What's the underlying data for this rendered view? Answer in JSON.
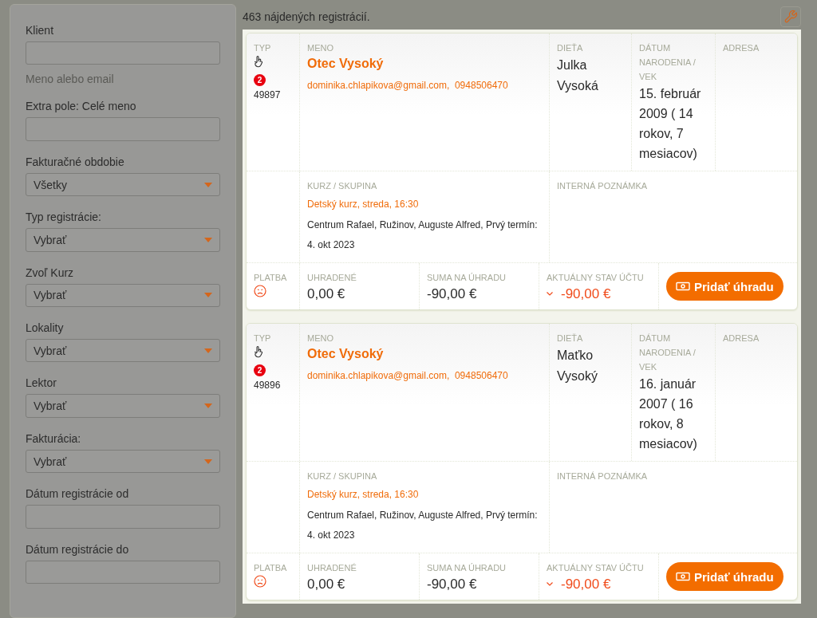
{
  "filters": [
    {
      "kind": "text",
      "label": "Klient",
      "hint": "Meno alebo email"
    },
    {
      "kind": "text",
      "label": "Extra pole: Celé meno"
    },
    {
      "kind": "select",
      "label": "Fakturačné obdobie",
      "value": "Všetky"
    },
    {
      "kind": "select",
      "label": "Typ registrácie:",
      "value": "Vybrať"
    },
    {
      "kind": "select",
      "label": "Zvoľ Kurz",
      "value": "Vybrať"
    },
    {
      "kind": "select",
      "label": "Lokality",
      "value": "Vybrať"
    },
    {
      "kind": "select",
      "label": "Lektor",
      "value": "Vybrať"
    },
    {
      "kind": "select",
      "label": "Fakturácia:",
      "value": "Vybrať"
    },
    {
      "kind": "text",
      "label": "Dátum registrácie od"
    },
    {
      "kind": "text",
      "label": "Dátum registrácie do"
    }
  ],
  "result_count": "463 nájdených registrácií.",
  "registrations": [
    {
      "headers": {
        "type": "TYP",
        "name": "MENO",
        "child": "DIEŤA",
        "birth": "DÁTUM NARODENIA / VEK",
        "address": "ADRESA",
        "course": "KURZ / SKUPINA",
        "note": "INTERNÁ POZNÁMKA",
        "payment": "PLATBA",
        "paid": "UHRADENÉ",
        "due": "SUMA NA ÚHRADU",
        "balance": "AKTUÁLNY STAV ÚČTU"
      },
      "badge": "2",
      "id": "49897",
      "name": "Otec Vysoký",
      "email": "dominika.chlapikova@gmail.com,",
      "phone": "0948506470",
      "child": "Julka Vysoká",
      "birth": "15. február 2009 ( 14 rokov, 7 mesiacov)",
      "course": "Detský kurz, streda, 16:30",
      "course_detail": "Centrum Rafael, Ružinov, Auguste Alfred, Prvý termín: 4. okt 2023",
      "paid": "0,00 €",
      "due": "-90,00 €",
      "balance": "-90,00 €",
      "action": "Pridať úhradu"
    },
    {
      "headers": {
        "type": "TYP",
        "name": "MENO",
        "child": "DIEŤA",
        "birth": "DÁTUM NARODENIA / VEK",
        "address": "ADRESA",
        "course": "KURZ / SKUPINA",
        "note": "INTERNÁ POZNÁMKA",
        "payment": "PLATBA",
        "paid": "UHRADENÉ",
        "due": "SUMA NA ÚHRADU",
        "balance": "AKTUÁLNY STAV ÚČTU"
      },
      "badge": "2",
      "id": "49896",
      "name": "Otec Vysoký",
      "email": "dominika.chlapikova@gmail.com,",
      "phone": "0948506470",
      "child": "Maťko Vysoký",
      "birth": "16. január 2007 ( 16 rokov, 8 mesiacov)",
      "course": "Detský kurz, streda, 16:30",
      "course_detail": "Centrum Rafael, Ružinov, Auguste Alfred, Prvý termín: 4. okt 2023",
      "paid": "0,00 €",
      "due": "-90,00 €",
      "balance": "-90,00 €",
      "action": "Pridať úhradu"
    }
  ]
}
